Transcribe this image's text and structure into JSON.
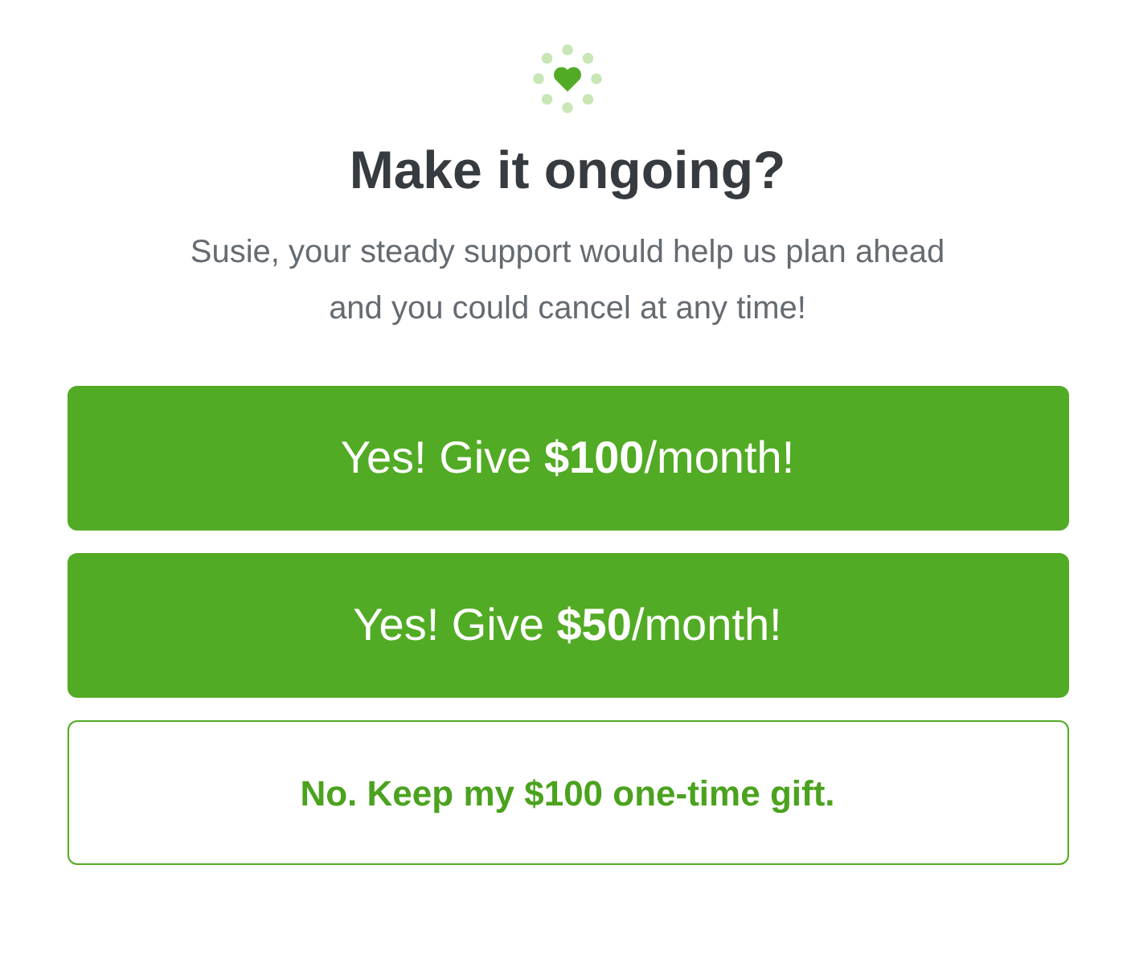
{
  "title": "Make it ongoing?",
  "message": "Susie, your steady support would help us plan ahead and you could cancel at any time!",
  "options": [
    {
      "kind": "filled",
      "label": "Yes! Give **$100**/month!"
    },
    {
      "kind": "filled",
      "label": "Yes! Give **$50**/month!"
    },
    {
      "kind": "outline",
      "label": "No. Keep my $100 one-time gift."
    }
  ]
}
